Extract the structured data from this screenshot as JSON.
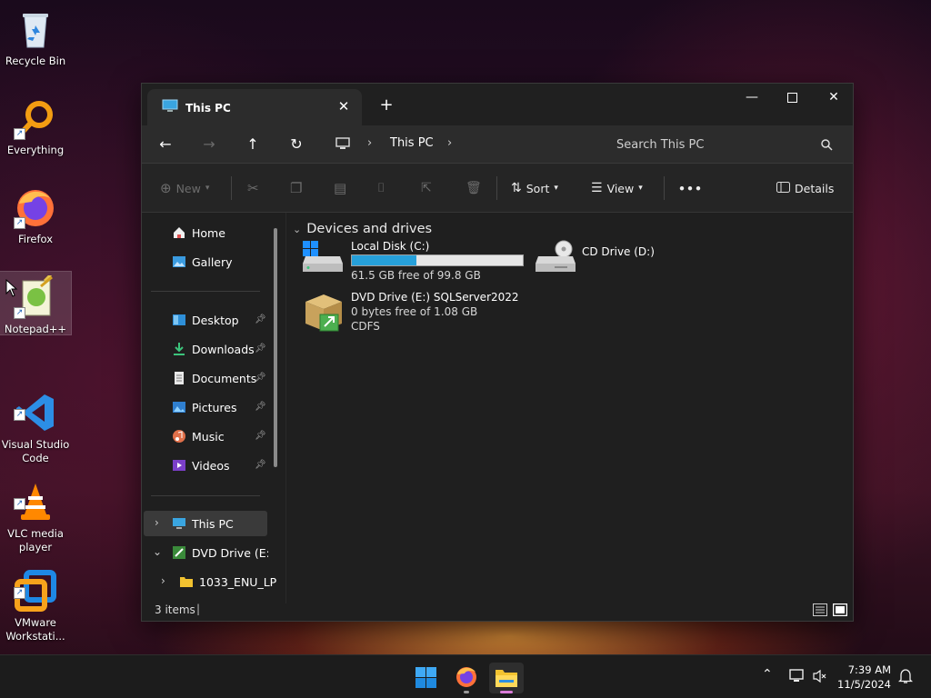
{
  "desktop": {
    "icons": [
      {
        "label": "Recycle Bin",
        "icon": "recycle-bin-icon"
      },
      {
        "label": "Everything",
        "icon": "everything-search-icon"
      },
      {
        "label": "Firefox",
        "icon": "firefox-icon"
      },
      {
        "label": "Notepad++",
        "icon": "notepad-plus-plus-icon"
      },
      {
        "label": "Visual Studio\nCode",
        "icon": "vscode-icon"
      },
      {
        "label": "VLC media\nplayer",
        "icon": "vlc-icon"
      },
      {
        "label": "VMware\nWorkstati...",
        "icon": "vmware-icon"
      }
    ]
  },
  "explorer": {
    "tab_title": "This PC",
    "breadcrumb": [
      "This PC"
    ],
    "search_placeholder": "Search This PC",
    "toolbar": {
      "new_label": "New",
      "sort_label": "Sort",
      "view_label": "View",
      "more_label": "•••",
      "details_label": "Details"
    },
    "sidebar": {
      "quick": [
        {
          "label": "Home"
        },
        {
          "label": "Gallery"
        }
      ],
      "pinned": [
        {
          "label": "Desktop"
        },
        {
          "label": "Downloads"
        },
        {
          "label": "Documents"
        },
        {
          "label": "Pictures"
        },
        {
          "label": "Music"
        },
        {
          "label": "Videos"
        }
      ],
      "tree": [
        {
          "label": "This PC"
        },
        {
          "label": "DVD Drive (E:) SQ"
        },
        {
          "label": "1033_ENU_LP"
        }
      ]
    },
    "content": {
      "group_title": "Devices and drives",
      "drives": [
        {
          "name": "Local Disk (C:)",
          "free": "61.5 GB free of 99.8 GB",
          "used_fraction": 0.38
        },
        {
          "name": "CD Drive (D:)"
        },
        {
          "name": "DVD Drive (E:) SQLServer2022",
          "free": "0 bytes free of 1.08 GB",
          "fs": "CDFS"
        }
      ]
    },
    "status": {
      "items": "3 items"
    }
  },
  "taskbar": {
    "time": "7:39 AM",
    "date": "11/5/2024"
  },
  "colors": {
    "accent": "#26a0da",
    "window_bg": "#1f1f1f",
    "taskbar_bg": "#1c1c1c"
  }
}
